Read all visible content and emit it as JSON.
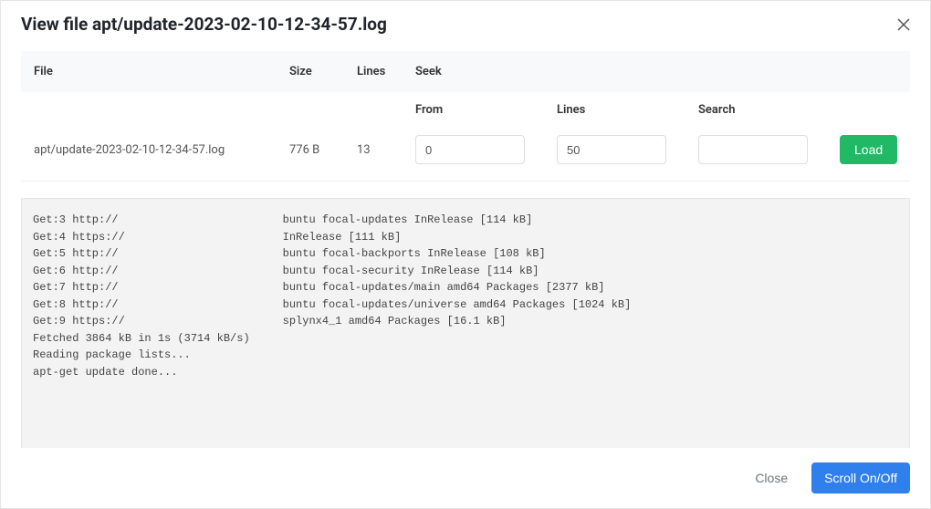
{
  "header": {
    "title": "View file apt/update-2023-02-10-12-34-57.log"
  },
  "columns": {
    "file": "File",
    "size": "Size",
    "lines": "Lines",
    "seek": "Seek",
    "from": "From",
    "seek_lines": "Lines",
    "search": "Search"
  },
  "file": {
    "name": "apt/update-2023-02-10-12-34-57.log",
    "size": "776 B",
    "lines": "13"
  },
  "seek": {
    "from_value": "0",
    "lines_value": "50",
    "search_value": ""
  },
  "buttons": {
    "load": "Load",
    "close": "Close",
    "scroll": "Scroll On/Off"
  },
  "log_content": "Get:3 http://                         buntu focal-updates InRelease [114 kB]\nGet:4 https://                        InRelease [111 kB]\nGet:5 http://                         buntu focal-backports InRelease [108 kB]\nGet:6 http://                         buntu focal-security InRelease [114 kB]\nGet:7 http://                         buntu focal-updates/main amd64 Packages [2377 kB]\nGet:8 http://                         buntu focal-updates/universe amd64 Packages [1024 kB]\nGet:9 https://                        splynx4_1 amd64 Packages [16.1 kB]\nFetched 3864 kB in 1s (3714 kB/s)\nReading package lists...\napt-get update done..."
}
